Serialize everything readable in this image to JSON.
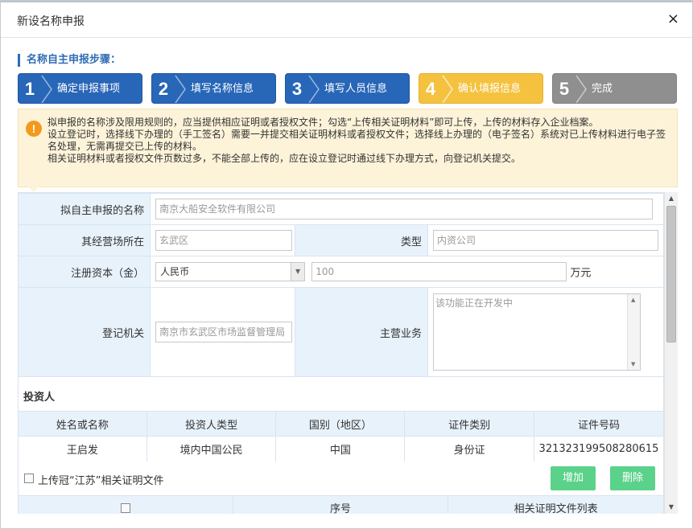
{
  "dialog": {
    "title": "新设名称申报",
    "close_glyph": "×"
  },
  "steps_heading": "名称自主申报步骤：",
  "steps": [
    {
      "num": "1",
      "label": "确定申报事项",
      "state": "done",
      "color": "#2866b8"
    },
    {
      "num": "2",
      "label": "填写名称信息",
      "state": "done",
      "color": "#2866b8"
    },
    {
      "num": "3",
      "label": "填写人员信息",
      "state": "done",
      "color": "#2866b8"
    },
    {
      "num": "4",
      "label": "确认填报信息",
      "state": "current",
      "color": "#f5c240"
    },
    {
      "num": "5",
      "label": "完成",
      "state": "pending",
      "color": "#8f8f8f"
    }
  ],
  "notice": {
    "icon": "warning-icon",
    "icon_glyph": "!",
    "paragraphs": [
      "拟申报的名称涉及限用规则的，应当提供相应证明或者授权文件；勾选“上传相关证明材料”即可上传，上传的材料存入企业档案。",
      "设立登记时，选择线下办理的（手工签名）需要一并提交相关证明材料或者授权文件；选择线上办理的（电子签名）系统对已上传材料进行电子签名处理，无需再提交已上传的材料。",
      "相关证明材料或者授权文件页数过多，不能全部上传的，应在设立登记时通过线下办理方式，向登记机关提交。"
    ]
  },
  "form": {
    "name_label": "拟自主申报的名称",
    "name_value": "南京大船安全软件有限公司",
    "location_label": "其经营场所在",
    "location_value": "玄武区",
    "type_label": "类型",
    "type_value": "内资公司",
    "capital_label": "注册资本（金）",
    "currency_value": "人民币",
    "capital_value": "100",
    "capital_unit": "万元",
    "authority_label": "登记机关",
    "authority_value": "南京市玄武区市场监督管理局",
    "business_label": "主营业务",
    "business_placeholder": "该功能正在开发中"
  },
  "investors": {
    "heading": "投资人",
    "columns": [
      "姓名或名称",
      "投资人类型",
      "国别（地区）",
      "证件类别",
      "证件号码"
    ],
    "rows": [
      [
        "王启发",
        "境内中国公民",
        "中国",
        "身份证",
        "321323199508280615"
      ]
    ]
  },
  "upload": {
    "label": "上传冠“江苏”相关证明文件",
    "add_button": "增加",
    "delete_button": "删除"
  },
  "files_table": {
    "columns": [
      "",
      "序号",
      "相关证明文件列表"
    ]
  },
  "colors": {
    "accent_blue": "#2866b8",
    "current_step": "#f5c240",
    "pending_step": "#8f8f8f",
    "notice_bg": "#fdf3d9",
    "warning_icon": "#f29a1c",
    "label_bg": "#e8f2fb",
    "green_button": "#5bd28a"
  }
}
